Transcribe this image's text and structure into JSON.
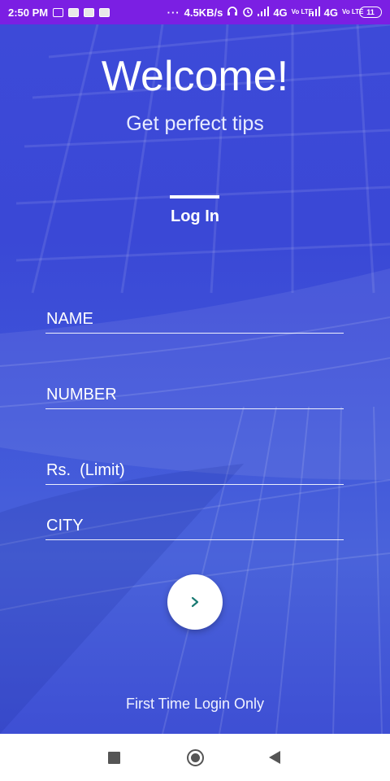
{
  "status_bar": {
    "time": "2:50 PM",
    "network_speed": "4.5KB/s",
    "signal1": "4G",
    "signal1_tag": "Vo LTE",
    "signal2": "4G",
    "signal2_tag": "Vo LTE",
    "battery": "11",
    "dots": "···",
    "background_color": "#7b1fe3"
  },
  "header": {
    "title": "Welcome!",
    "subtitle": "Get perfect tips"
  },
  "tabs": {
    "active_label": "Log In"
  },
  "form": {
    "name_placeholder": "NAME",
    "number_placeholder": "NUMBER",
    "limit_placeholder": "Rs.  (Limit)",
    "city_placeholder": "CITY"
  },
  "submit": {
    "icon": "chevron-right-icon",
    "icon_color": "#1a7a73"
  },
  "footer": {
    "note": "First Time Login Only"
  },
  "navigation": {
    "recents_icon": "square-icon",
    "home_icon": "circle-icon",
    "back_icon": "triangle-back-icon"
  },
  "colors": {
    "background_blue": "#3d4ad8",
    "text": "#ffffff"
  }
}
